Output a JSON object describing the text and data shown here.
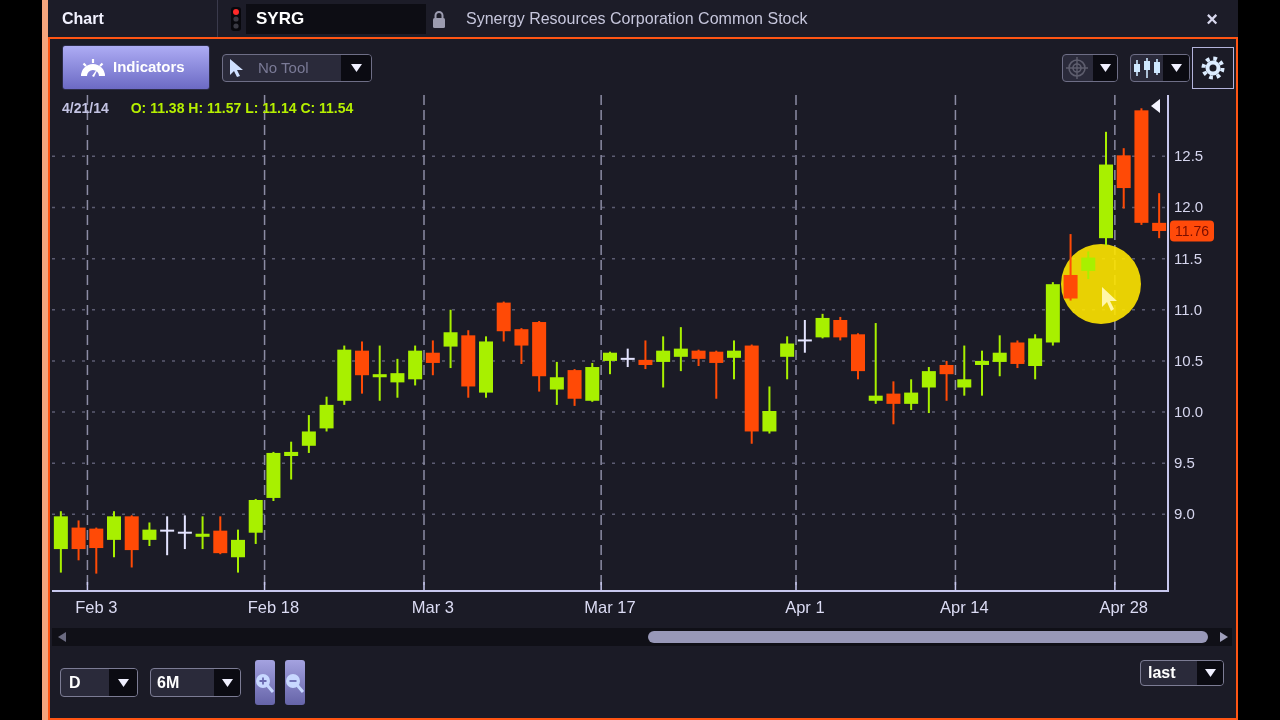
{
  "header": {
    "title": "Chart",
    "symbol": "SYRG",
    "description": "Synergy Resources Corporation Common Stock",
    "close": "×"
  },
  "toolbar": {
    "indicators": "Indicators",
    "tool": {
      "value": "No Tool",
      "disabled": true
    }
  },
  "chart": {
    "readout_date": "4/21/14",
    "readout_ohlc": "O: 11.38 H: 11.57 L: 11.14 C: 11.54",
    "last_price": "11.76",
    "chart_data": {
      "type": "candlestick",
      "grid": true,
      "ylim": [
        8.25,
        13.1
      ],
      "categories": [
        null,
        null,
        "Feb 3",
        null,
        null,
        null,
        null,
        null,
        null,
        null,
        null,
        null,
        "Feb 18",
        null,
        null,
        null,
        null,
        null,
        null,
        null,
        null,
        "Mar 3",
        null,
        null,
        null,
        null,
        null,
        null,
        null,
        null,
        null,
        "Mar 17",
        null,
        null,
        null,
        null,
        null,
        null,
        null,
        null,
        null,
        null,
        "Apr 1",
        null,
        null,
        null,
        null,
        null,
        null,
        null,
        null,
        "Apr 14",
        null,
        null,
        null,
        null,
        null,
        null,
        null,
        null,
        "Apr 28",
        null,
        null
      ],
      "yticks": [
        {
          "value": 9,
          "label": "9.0"
        },
        {
          "value": 9.5,
          "label": "9.5"
        },
        {
          "value": 10,
          "label": "10.0"
        },
        {
          "value": 10.5,
          "label": "10.5"
        },
        {
          "value": 11,
          "label": "11.0"
        },
        {
          "value": 11.5,
          "label": "11.5"
        },
        {
          "value": 12,
          "label": "12.0"
        },
        {
          "value": 12.5,
          "label": "12.5"
        }
      ],
      "ohlc": [
        [
          8.66,
          9.03,
          8.43,
          8.98
        ],
        [
          8.87,
          8.94,
          8.55,
          8.66
        ],
        [
          8.86,
          8.87,
          8.42,
          8.67
        ],
        [
          8.75,
          9.03,
          8.58,
          8.98
        ],
        [
          8.98,
          8.99,
          8.48,
          8.65
        ],
        [
          8.75,
          8.92,
          8.69,
          8.85
        ],
        [
          8.84,
          8.98,
          8.6,
          8.84
        ],
        [
          8.82,
          8.99,
          8.66,
          8.82
        ],
        [
          8.78,
          8.98,
          8.66,
          8.81
        ],
        [
          8.84,
          8.98,
          8.61,
          8.62
        ],
        [
          8.58,
          8.85,
          8.43,
          8.75
        ],
        [
          8.82,
          9.15,
          8.71,
          9.14
        ],
        [
          9.16,
          9.61,
          9.13,
          9.6
        ],
        [
          9.57,
          9.71,
          9.34,
          9.61
        ],
        [
          9.67,
          9.97,
          9.6,
          9.81
        ],
        [
          9.84,
          10.15,
          9.81,
          10.07
        ],
        [
          10.11,
          10.65,
          10.07,
          10.61
        ],
        [
          10.6,
          10.69,
          10.18,
          10.36
        ],
        [
          10.34,
          10.65,
          10.11,
          10.37
        ],
        [
          10.29,
          10.52,
          10.14,
          10.38
        ],
        [
          10.32,
          10.65,
          10.26,
          10.6
        ],
        [
          10.58,
          10.7,
          10.36,
          10.48
        ],
        [
          10.64,
          11.0,
          10.43,
          10.78
        ],
        [
          10.75,
          10.8,
          10.14,
          10.25
        ],
        [
          10.19,
          10.74,
          10.14,
          10.69
        ],
        [
          11.07,
          11.08,
          10.69,
          10.79
        ],
        [
          10.81,
          10.82,
          10.47,
          10.65
        ],
        [
          10.88,
          10.89,
          10.2,
          10.35
        ],
        [
          10.22,
          10.49,
          10.07,
          10.34
        ],
        [
          10.41,
          10.42,
          10.06,
          10.13
        ],
        [
          10.11,
          10.48,
          10.1,
          10.44
        ],
        [
          10.5,
          10.59,
          10.37,
          10.58
        ],
        [
          10.52,
          10.62,
          10.44,
          10.52
        ],
        [
          10.51,
          10.7,
          10.42,
          10.46
        ],
        [
          10.49,
          10.74,
          10.24,
          10.6
        ],
        [
          10.54,
          10.83,
          10.4,
          10.62
        ],
        [
          10.6,
          10.61,
          10.45,
          10.52
        ],
        [
          10.59,
          10.6,
          10.13,
          10.48
        ],
        [
          10.53,
          10.7,
          10.32,
          10.6
        ],
        [
          10.65,
          10.66,
          9.69,
          9.81
        ],
        [
          9.81,
          10.25,
          9.79,
          10.01
        ],
        [
          10.54,
          10.74,
          10.32,
          10.67
        ],
        [
          10.7,
          10.9,
          10.58,
          10.7
        ],
        [
          10.73,
          10.96,
          10.72,
          10.92
        ],
        [
          10.9,
          10.93,
          10.7,
          10.73
        ],
        [
          10.76,
          10.77,
          10.32,
          10.4
        ],
        [
          10.11,
          10.87,
          10.08,
          10.16
        ],
        [
          10.18,
          10.3,
          9.88,
          10.08
        ],
        [
          10.08,
          10.32,
          10.02,
          10.19
        ],
        [
          10.24,
          10.44,
          9.99,
          10.4
        ],
        [
          10.46,
          10.5,
          10.11,
          10.37
        ],
        [
          10.24,
          10.65,
          10.16,
          10.32
        ],
        [
          10.46,
          10.6,
          10.16,
          10.5
        ],
        [
          10.49,
          10.75,
          10.35,
          10.58
        ],
        [
          10.68,
          10.7,
          10.43,
          10.47
        ],
        [
          10.45,
          10.76,
          10.32,
          10.72
        ],
        [
          10.68,
          11.27,
          10.65,
          11.25
        ],
        [
          11.34,
          11.74,
          11.09,
          11.11
        ],
        [
          11.38,
          11.57,
          11.3,
          11.51
        ],
        [
          11.7,
          12.74,
          11.63,
          12.42
        ],
        [
          12.51,
          12.58,
          11.99,
          12.19
        ],
        [
          12.95,
          12.97,
          11.83,
          11.85
        ],
        [
          11.85,
          12.14,
          11.7,
          11.77
        ]
      ]
    }
  },
  "footer": {
    "interval": "D",
    "range": "6M",
    "price_field": "last"
  }
}
